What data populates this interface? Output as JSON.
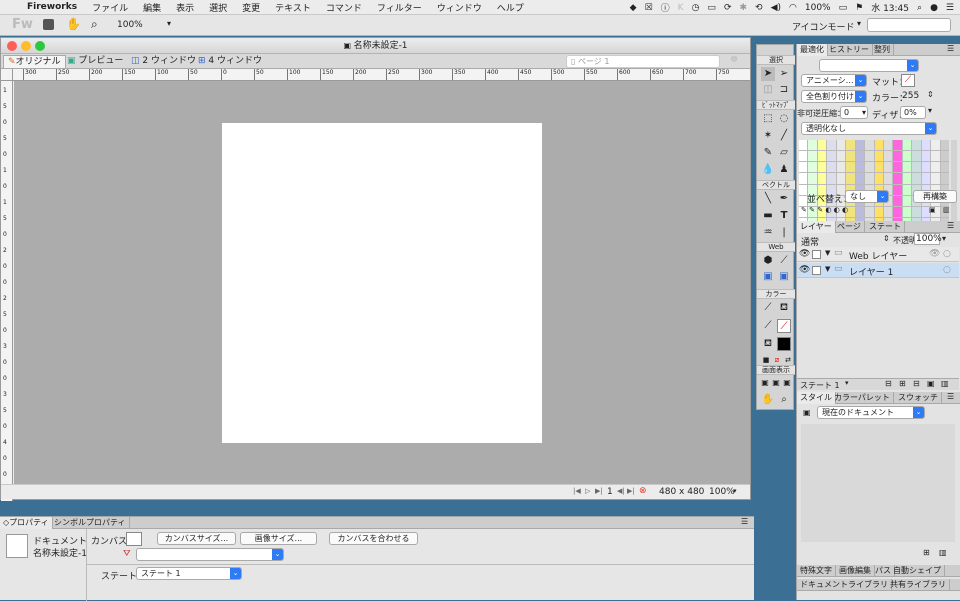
{
  "menubar": {
    "apple": "",
    "app": "Fireworks",
    "items": [
      "ファイル",
      "編集",
      "表示",
      "選択",
      "変更",
      "テキスト",
      "コマンド",
      "フィルター",
      "ウィンドウ",
      "ヘルプ"
    ],
    "battery": "100%",
    "time": "水 13:45"
  },
  "toolbar": {
    "logo": "Fw",
    "zoom": "100%",
    "mode": "アイコンモード"
  },
  "document": {
    "title": "名称未設定-1",
    "tabs": [
      "オリジナル",
      "プレビュー",
      "2 ウィンドウ",
      "4 ウィンドウ"
    ],
    "page_select": "ページ 1",
    "size": "480 x 480",
    "zoom": "100%",
    "frame": "1"
  },
  "ruler": {
    "h_labels": [
      "300",
      "250",
      "200",
      "150",
      "100",
      "50",
      "0",
      "50",
      "100",
      "150",
      "200",
      "250",
      "300",
      "350",
      "400",
      "450",
      "500",
      "550",
      "600",
      "650",
      "700",
      "750"
    ],
    "v_labels": [
      "1",
      "5",
      "0",
      "5",
      "0",
      "1",
      "0",
      "1",
      "5",
      "0",
      "2",
      "0",
      "0",
      "2",
      "5",
      "0",
      "3",
      "0",
      "0",
      "3",
      "5",
      "0",
      "4",
      "0",
      "0"
    ]
  },
  "tools": {
    "headers": [
      "選択",
      "ﾋﾞｯﾄﾏｯﾌﾟ",
      "ベクトル",
      "Web",
      "カラー",
      "画面表示"
    ]
  },
  "optimize": {
    "tabs": [
      "最適化",
      "ヒストリー",
      "整列"
    ],
    "anim": "アニメーシ…",
    "matte_label": "マット：",
    "all_trim": "全色割り付け",
    "colors_label": "カラー：",
    "colors": "255",
    "loss_label": "非可逆圧縮：",
    "loss": "0",
    "dither_label": "ディザ：",
    "dither": "0%",
    "transparency": "透明化なし",
    "sort_label": "並べ替え：",
    "sort": "なし",
    "rebuild": "再構築"
  },
  "layers": {
    "tabs": [
      "レイヤー",
      "ページ",
      "ステート"
    ],
    "blend": "通常",
    "opacity_label": "不透明度",
    "opacity": "100%",
    "rows": [
      "Web レイヤー",
      "レイヤー 1"
    ],
    "state": "ステート 1"
  },
  "styles": {
    "tabs": [
      "スタイル",
      "カラーパレット",
      "スウォッチ"
    ],
    "doc": "現在のドキュメント"
  },
  "bottom_tabs1": [
    "特殊文字",
    "画像編集",
    "パス",
    "自動シェイプ"
  ],
  "bottom_tabs2": [
    "ドキュメントライブラリ",
    "共有ライブラリ"
  ],
  "props": {
    "tabs": [
      "プロパティ",
      "シンボルプロパティ"
    ],
    "doc_type": "ドキュメント",
    "doc_name": "名称未設定-1",
    "canvas_label": "カンバス：",
    "canvas_size_btn": "カンバスサイズ...",
    "image_size_btn": "画像サイズ...",
    "fit_canvas_btn": "カンバスを合わせる",
    "state_label": "ステート：",
    "state": "ステート 1"
  },
  "colors": {
    "accent": "#2f7bf5",
    "canvas_bg": "#acacac",
    "selected_row": "#c9ddf3"
  }
}
